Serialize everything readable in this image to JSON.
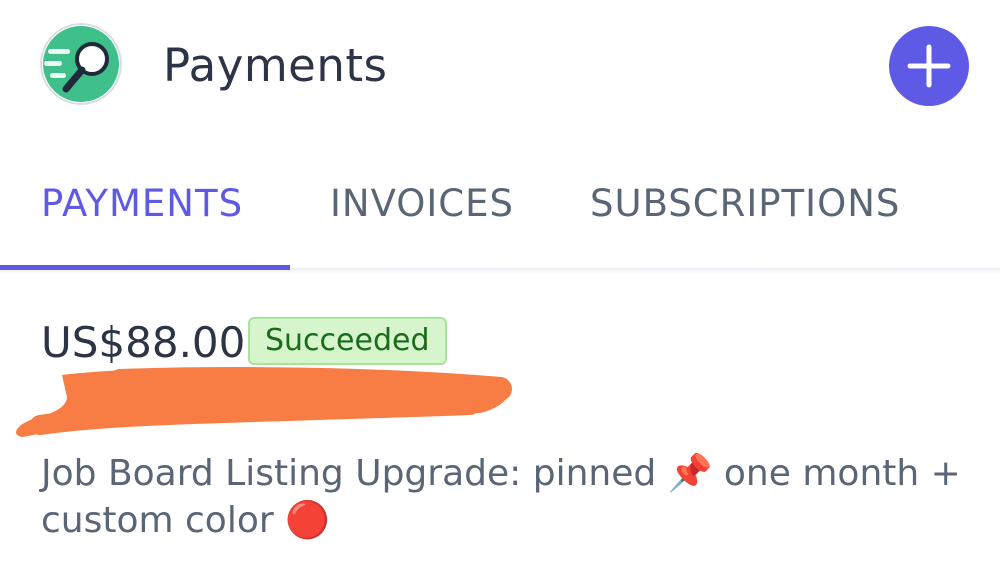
{
  "header": {
    "title": "Payments",
    "logo_icon": "magnifier-logo-icon",
    "add_icon": "plus-icon"
  },
  "tabs": [
    {
      "label": "PAYMENTS",
      "active": true
    },
    {
      "label": "INVOICES",
      "active": false
    },
    {
      "label": "SUBSCRIPTIONS",
      "active": false
    }
  ],
  "payment": {
    "amount": "US$88.00",
    "status": "Succeeded",
    "customer": "",
    "description": "Job Board Listing Upgrade: pinned 📌 one month + custom color 🔴"
  },
  "colors": {
    "accent": "#5e5ae6",
    "success_bg": "#d6f5cc",
    "success_text": "#1a6b1a",
    "redaction": "#f77d45"
  }
}
